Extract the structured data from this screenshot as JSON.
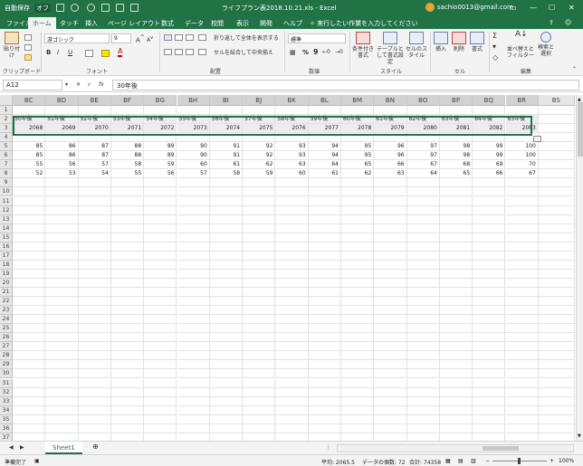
{
  "titlebar": {
    "autosave": "自動保存",
    "autosave_state": "オフ",
    "title": "ライフプラン表2018.10.21.xls  -  Excel",
    "user": "sachio0013@gmail.com"
  },
  "tabs": [
    "ファイル",
    "ホーム",
    "タッチ",
    "挿入",
    "ページ レイアウト",
    "数式",
    "データ",
    "校閲",
    "表示",
    "開発",
    "ヘルプ"
  ],
  "tell_me": "実行したい作業を入力してください",
  "ribbon": {
    "clipboard": {
      "paste": "貼り付け",
      "label": "クリップボード"
    },
    "font": {
      "name": "游ゴシック",
      "size": "9",
      "bold": "B",
      "italic": "I",
      "underline": "U",
      "label": "フォント"
    },
    "alignment": {
      "wrap": "折り返して全体を表示する",
      "merge": "セルを結合して中央揃え",
      "label": "配置"
    },
    "number": {
      "format": "標準",
      "label": "数値"
    },
    "styles": {
      "conditional": "条件付き書式",
      "table": "テーブルとして書式設定",
      "cell": "セルのスタイル",
      "label": "スタイル"
    },
    "cells": {
      "insert": "挿入",
      "delete": "削除",
      "format": "書式",
      "label": "セル"
    },
    "editing": {
      "sort": "並べ替えとフィルター",
      "find": "検索と選択",
      "label": "編集"
    }
  },
  "formula": {
    "namebox": "A12",
    "fx": "fx",
    "value": "30年後"
  },
  "columns": [
    "BC",
    "BD",
    "BE",
    "BF",
    "BG",
    "BH",
    "BI",
    "BJ",
    "BK",
    "BL",
    "BM",
    "BN",
    "BO",
    "BP",
    "BQ",
    "BR",
    "BS"
  ],
  "row_numbers": [
    "1",
    "2",
    "3",
    "4",
    "5",
    "6",
    "7",
    "8",
    "9",
    "10",
    "11",
    "12",
    "13",
    "14",
    "15",
    "16",
    "17",
    "18",
    "19",
    "20",
    "21",
    "22",
    "23",
    "24",
    "25",
    "26",
    "27",
    "28",
    "29",
    "30",
    "31",
    "32",
    "33",
    "34",
    "35",
    "36",
    "37"
  ],
  "rows": {
    "r2": [
      "50年後",
      "51年後",
      "52年後",
      "53年後",
      "54年後",
      "55年後",
      "56年後",
      "57年後",
      "58年後",
      "59年後",
      "60年後",
      "61年後",
      "62年後",
      "63年後",
      "64年後",
      "65年後"
    ],
    "r3": [
      "2068",
      "2069",
      "2070",
      "2071",
      "2072",
      "2073",
      "2074",
      "2075",
      "2076",
      "2077",
      "2078",
      "2079",
      "2080",
      "2081",
      "2082",
      "2083"
    ],
    "r5": [
      "85",
      "86",
      "87",
      "88",
      "89",
      "90",
      "91",
      "92",
      "93",
      "94",
      "95",
      "96",
      "97",
      "98",
      "99",
      "100"
    ],
    "r6": [
      "85",
      "86",
      "87",
      "88",
      "89",
      "90",
      "91",
      "92",
      "93",
      "94",
      "95",
      "96",
      "97",
      "98",
      "99",
      "100"
    ],
    "r7": [
      "55",
      "56",
      "57",
      "58",
      "59",
      "60",
      "61",
      "62",
      "63",
      "64",
      "65",
      "66",
      "67",
      "68",
      "69",
      "70"
    ],
    "r8": [
      "52",
      "53",
      "54",
      "55",
      "56",
      "57",
      "58",
      "59",
      "60",
      "61",
      "62",
      "63",
      "64",
      "65",
      "66",
      "67"
    ]
  },
  "sheet_tab": "Sheet1",
  "status": {
    "ready": "準備完了",
    "average": "平均: 2065.5",
    "count": "データの個数: 72",
    "sum": "合計: 74358",
    "zoom": "100%"
  },
  "colors": {
    "accent": "#217346",
    "header_fill": "#ededed"
  }
}
